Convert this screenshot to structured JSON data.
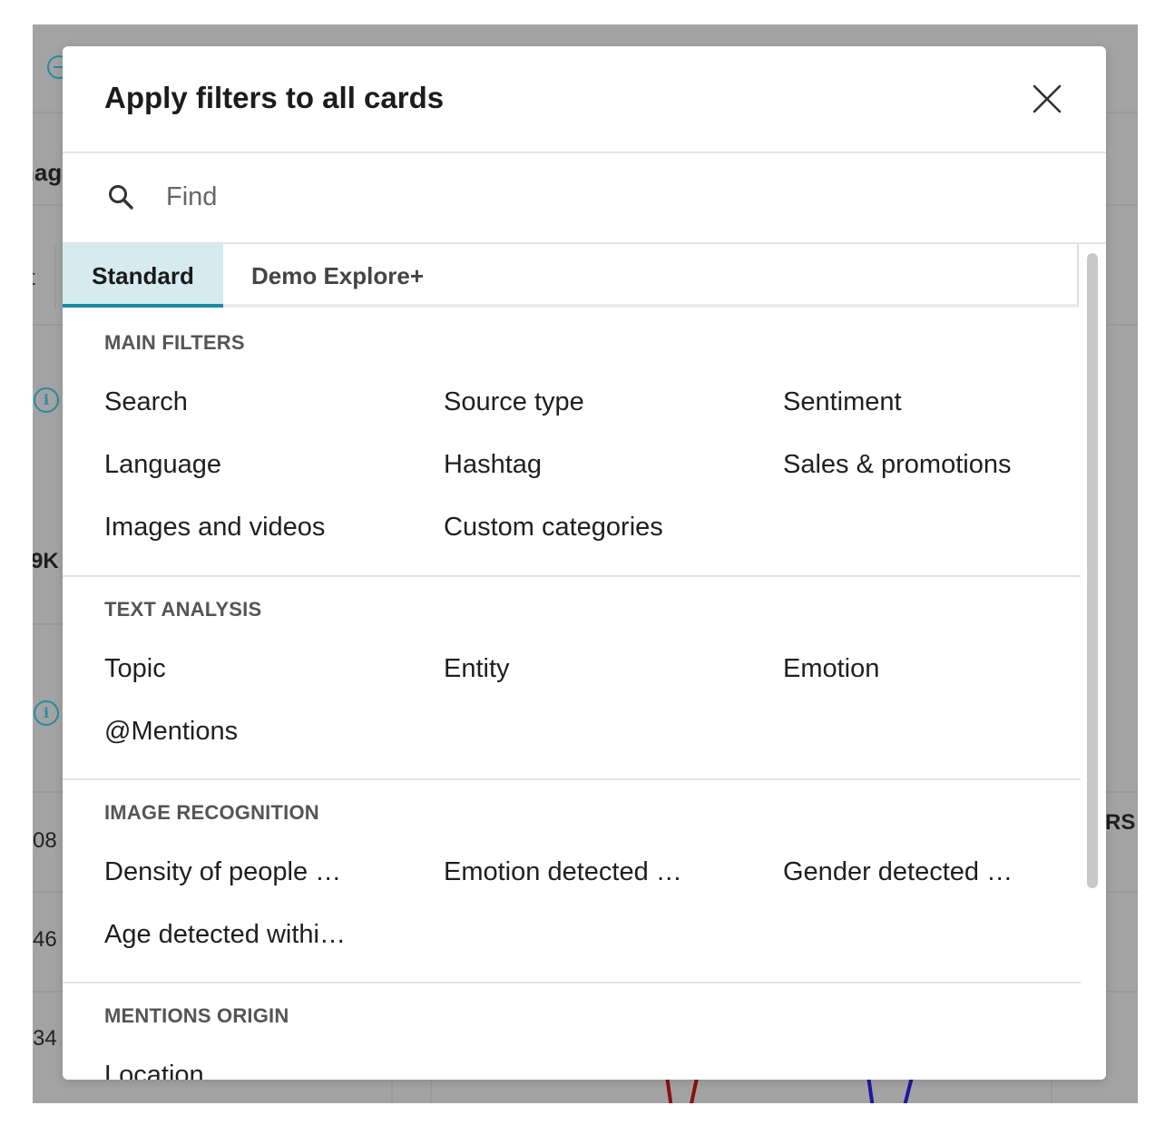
{
  "background": {
    "fragments": [
      "nag",
      "t",
      "9K",
      "08",
      "46",
      "34",
      "RS"
    ]
  },
  "modal": {
    "title": "Apply filters to all cards",
    "search_placeholder": "Find",
    "tabs": [
      {
        "label": "Standard",
        "active": true
      },
      {
        "label": "Demo Explore+",
        "active": false
      }
    ],
    "sections": [
      {
        "label": "MAIN FILTERS",
        "items": [
          "Search",
          "Source type",
          "Sentiment",
          "Language",
          "Hashtag",
          "Sales & promotions",
          "Images and videos",
          "Custom categories"
        ]
      },
      {
        "label": "TEXT ANALYSIS",
        "items": [
          "Topic",
          "Entity",
          "Emotion",
          "@Mentions"
        ]
      },
      {
        "label": "IMAGE RECOGNITION",
        "items": [
          "Density of people …",
          "Emotion detected …",
          "Gender detected …",
          "Age detected withi…"
        ]
      },
      {
        "label": "MENTIONS ORIGIN",
        "items": [
          "Location"
        ]
      }
    ]
  },
  "colors": {
    "accent": "#1c8ca1",
    "active_tab_bg": "#d5ebef",
    "overlay": "#a3a3a3"
  }
}
